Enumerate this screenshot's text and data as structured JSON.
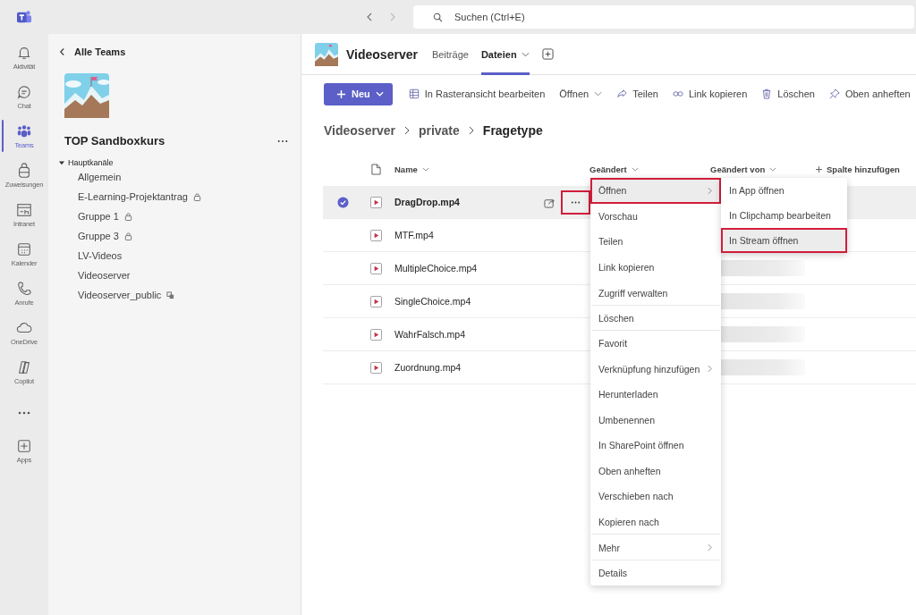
{
  "app_bar": {
    "search": {
      "placeholder": "Suchen (Ctrl+E)"
    }
  },
  "rail": [
    {
      "label": "Aktivität",
      "selected": false
    },
    {
      "label": "Chat",
      "selected": false
    },
    {
      "label": "Teams",
      "selected": true
    },
    {
      "label": "Zuweisungen",
      "selected": false
    },
    {
      "label": "Intranet",
      "selected": false
    },
    {
      "label": "Kalender",
      "selected": false
    },
    {
      "label": "Anrufe",
      "selected": false
    },
    {
      "label": "OneDrive",
      "selected": false
    },
    {
      "label": "Copilot",
      "selected": false
    },
    {
      "label": "Apps",
      "selected": false
    }
  ],
  "panel": {
    "back": "Alle Teams",
    "team_name": "TOP Sandboxkurs",
    "section": "Hauptkanäle",
    "expanded": true,
    "channels": [
      {
        "name": "Allgemein",
        "kind": "standard"
      },
      {
        "name": "E-Learning-Projektantrag",
        "kind": "private"
      },
      {
        "name": "Gruppe 1",
        "kind": "private"
      },
      {
        "name": "Gruppe 3",
        "kind": "private"
      },
      {
        "name": "LV-Videos",
        "kind": "standard"
      },
      {
        "name": "Videoserver",
        "kind": "standard"
      },
      {
        "name": "Videoserver_public",
        "kind": "shared"
      }
    ]
  },
  "channel_header": {
    "title": "Videoserver",
    "tabs": [
      {
        "label": "Beiträge",
        "selected": false,
        "dropdown": false
      },
      {
        "label": "Dateien",
        "selected": true,
        "dropdown": true
      }
    ]
  },
  "toolbar": {
    "new": "Neu",
    "actions": [
      {
        "label": "In Rasteransicht bearbeiten",
        "dropdown": false
      },
      {
        "label": "Öffnen",
        "dropdown": true
      },
      {
        "label": "Teilen",
        "dropdown": false
      },
      {
        "label": "Link kopieren",
        "dropdown": false
      },
      {
        "label": "Löschen",
        "dropdown": false
      },
      {
        "label": "Oben anheften",
        "dropdown": false
      }
    ]
  },
  "breadcrumb": [
    "Videoserver",
    "private",
    "Fragetype"
  ],
  "table": {
    "columns": [
      "Name",
      "Geändert",
      "Geändert von",
      "Spalte hinzufügen"
    ],
    "rows": [
      {
        "name": "DragDrop.mp4",
        "selected": true
      },
      {
        "name": "MTF.mp4",
        "selected": false
      },
      {
        "name": "MultipleChoice.mp4",
        "selected": false,
        "redacted": true
      },
      {
        "name": "SingleChoice.mp4",
        "selected": false,
        "redacted": true
      },
      {
        "name": "WahrFalsch.mp4",
        "selected": false,
        "redacted": true
      },
      {
        "name": "Zuordnung.mp4",
        "selected": false,
        "redacted": true
      }
    ],
    "more_button_highlighted": true
  },
  "context_menu": {
    "items": [
      {
        "label": "Öffnen",
        "submenu": true,
        "hovered": true,
        "highlighted": true,
        "separator_after": false
      },
      {
        "label": "Vorschau",
        "submenu": false,
        "hovered": false,
        "highlighted": false,
        "separator_after": false
      },
      {
        "label": "Teilen",
        "submenu": false,
        "hovered": false,
        "highlighted": false,
        "separator_after": false
      },
      {
        "label": "Link kopieren",
        "submenu": false,
        "hovered": false,
        "highlighted": false,
        "separator_after": false
      },
      {
        "label": "Zugriff verwalten",
        "submenu": false,
        "hovered": false,
        "highlighted": false,
        "separator_after": true
      },
      {
        "label": "Löschen",
        "submenu": false,
        "hovered": false,
        "highlighted": false,
        "separator_after": true
      },
      {
        "label": "Favorit",
        "submenu": false,
        "hovered": false,
        "highlighted": false,
        "separator_after": false
      },
      {
        "label": "Verknüpfung hinzufügen",
        "submenu": true,
        "hovered": false,
        "highlighted": false,
        "separator_after": false
      },
      {
        "label": "Herunterladen",
        "submenu": false,
        "hovered": false,
        "highlighted": false,
        "separator_after": false
      },
      {
        "label": "Umbenennen",
        "submenu": false,
        "hovered": false,
        "highlighted": false,
        "separator_after": false
      },
      {
        "label": "In SharePoint öffnen",
        "submenu": false,
        "hovered": false,
        "highlighted": false,
        "separator_after": false
      },
      {
        "label": "Oben anheften",
        "submenu": false,
        "hovered": false,
        "highlighted": false,
        "separator_after": false
      },
      {
        "label": "Verschieben nach",
        "submenu": false,
        "hovered": false,
        "highlighted": false,
        "separator_after": false
      },
      {
        "label": "Kopieren nach",
        "submenu": false,
        "hovered": false,
        "highlighted": false,
        "separator_after": true
      },
      {
        "label": "Mehr",
        "submenu": true,
        "hovered": false,
        "highlighted": false,
        "separator_after": true
      },
      {
        "label": "Details",
        "submenu": false,
        "hovered": false,
        "highlighted": false,
        "separator_after": false
      }
    ]
  },
  "submenu": {
    "items": [
      {
        "label": "In App öffnen",
        "hovered": false,
        "highlighted": false
      },
      {
        "label": "In Clipchamp bearbeiten",
        "hovered": false,
        "highlighted": false
      },
      {
        "label": "In Stream öffnen",
        "hovered": true,
        "highlighted": true
      }
    ]
  }
}
